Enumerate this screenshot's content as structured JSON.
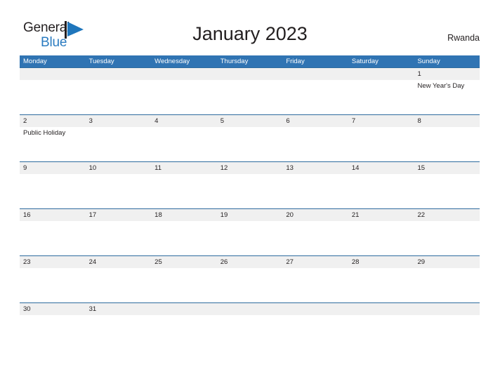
{
  "brand": {
    "name_part1": "General",
    "name_part2": "Blue",
    "mark_icon": "blue-triangle-flag-icon",
    "accent_color": "#2b7cc1"
  },
  "header": {
    "title": "January 2023",
    "country": "Rwanda"
  },
  "theme": {
    "header_blue": "#3074b3",
    "row_divider_blue": "#2e6b9e",
    "day_band_gray": "#f0f0f0",
    "text_color": "#231f20"
  },
  "calendar": {
    "weekdays": [
      "Monday",
      "Tuesday",
      "Wednesday",
      "Thursday",
      "Friday",
      "Saturday",
      "Sunday"
    ],
    "weeks": [
      {
        "days": [
          {
            "number": "",
            "event": ""
          },
          {
            "number": "",
            "event": ""
          },
          {
            "number": "",
            "event": ""
          },
          {
            "number": "",
            "event": ""
          },
          {
            "number": "",
            "event": ""
          },
          {
            "number": "",
            "event": ""
          },
          {
            "number": "1",
            "event": "New Year's Day"
          }
        ]
      },
      {
        "days": [
          {
            "number": "2",
            "event": "Public Holiday"
          },
          {
            "number": "3",
            "event": ""
          },
          {
            "number": "4",
            "event": ""
          },
          {
            "number": "5",
            "event": ""
          },
          {
            "number": "6",
            "event": ""
          },
          {
            "number": "7",
            "event": ""
          },
          {
            "number": "8",
            "event": ""
          }
        ]
      },
      {
        "days": [
          {
            "number": "9",
            "event": ""
          },
          {
            "number": "10",
            "event": ""
          },
          {
            "number": "11",
            "event": ""
          },
          {
            "number": "12",
            "event": ""
          },
          {
            "number": "13",
            "event": ""
          },
          {
            "number": "14",
            "event": ""
          },
          {
            "number": "15",
            "event": ""
          }
        ]
      },
      {
        "days": [
          {
            "number": "16",
            "event": ""
          },
          {
            "number": "17",
            "event": ""
          },
          {
            "number": "18",
            "event": ""
          },
          {
            "number": "19",
            "event": ""
          },
          {
            "number": "20",
            "event": ""
          },
          {
            "number": "21",
            "event": ""
          },
          {
            "number": "22",
            "event": ""
          }
        ]
      },
      {
        "days": [
          {
            "number": "23",
            "event": ""
          },
          {
            "number": "24",
            "event": ""
          },
          {
            "number": "25",
            "event": ""
          },
          {
            "number": "26",
            "event": ""
          },
          {
            "number": "27",
            "event": ""
          },
          {
            "number": "28",
            "event": ""
          },
          {
            "number": "29",
            "event": ""
          }
        ]
      },
      {
        "days": [
          {
            "number": "30",
            "event": ""
          },
          {
            "number": "31",
            "event": ""
          },
          {
            "number": "",
            "event": ""
          },
          {
            "number": "",
            "event": ""
          },
          {
            "number": "",
            "event": ""
          },
          {
            "number": "",
            "event": ""
          },
          {
            "number": "",
            "event": ""
          }
        ]
      }
    ]
  }
}
